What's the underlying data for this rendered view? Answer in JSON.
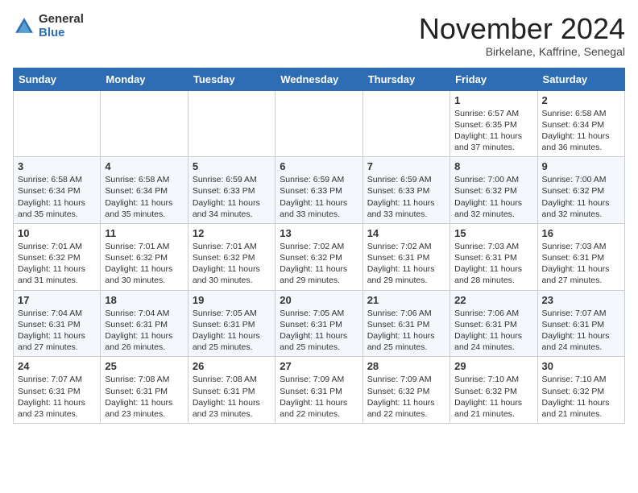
{
  "header": {
    "logo_general": "General",
    "logo_blue": "Blue",
    "month_title": "November 2024",
    "location": "Birkelane, Kaffrine, Senegal"
  },
  "weekdays": [
    "Sunday",
    "Monday",
    "Tuesday",
    "Wednesday",
    "Thursday",
    "Friday",
    "Saturday"
  ],
  "weeks": [
    [
      {
        "day": "",
        "info": ""
      },
      {
        "day": "",
        "info": ""
      },
      {
        "day": "",
        "info": ""
      },
      {
        "day": "",
        "info": ""
      },
      {
        "day": "",
        "info": ""
      },
      {
        "day": "1",
        "info": "Sunrise: 6:57 AM\nSunset: 6:35 PM\nDaylight: 11 hours and 37 minutes."
      },
      {
        "day": "2",
        "info": "Sunrise: 6:58 AM\nSunset: 6:34 PM\nDaylight: 11 hours and 36 minutes."
      }
    ],
    [
      {
        "day": "3",
        "info": "Sunrise: 6:58 AM\nSunset: 6:34 PM\nDaylight: 11 hours and 35 minutes."
      },
      {
        "day": "4",
        "info": "Sunrise: 6:58 AM\nSunset: 6:34 PM\nDaylight: 11 hours and 35 minutes."
      },
      {
        "day": "5",
        "info": "Sunrise: 6:59 AM\nSunset: 6:33 PM\nDaylight: 11 hours and 34 minutes."
      },
      {
        "day": "6",
        "info": "Sunrise: 6:59 AM\nSunset: 6:33 PM\nDaylight: 11 hours and 33 minutes."
      },
      {
        "day": "7",
        "info": "Sunrise: 6:59 AM\nSunset: 6:33 PM\nDaylight: 11 hours and 33 minutes."
      },
      {
        "day": "8",
        "info": "Sunrise: 7:00 AM\nSunset: 6:32 PM\nDaylight: 11 hours and 32 minutes."
      },
      {
        "day": "9",
        "info": "Sunrise: 7:00 AM\nSunset: 6:32 PM\nDaylight: 11 hours and 32 minutes."
      }
    ],
    [
      {
        "day": "10",
        "info": "Sunrise: 7:01 AM\nSunset: 6:32 PM\nDaylight: 11 hours and 31 minutes."
      },
      {
        "day": "11",
        "info": "Sunrise: 7:01 AM\nSunset: 6:32 PM\nDaylight: 11 hours and 30 minutes."
      },
      {
        "day": "12",
        "info": "Sunrise: 7:01 AM\nSunset: 6:32 PM\nDaylight: 11 hours and 30 minutes."
      },
      {
        "day": "13",
        "info": "Sunrise: 7:02 AM\nSunset: 6:32 PM\nDaylight: 11 hours and 29 minutes."
      },
      {
        "day": "14",
        "info": "Sunrise: 7:02 AM\nSunset: 6:31 PM\nDaylight: 11 hours and 29 minutes."
      },
      {
        "day": "15",
        "info": "Sunrise: 7:03 AM\nSunset: 6:31 PM\nDaylight: 11 hours and 28 minutes."
      },
      {
        "day": "16",
        "info": "Sunrise: 7:03 AM\nSunset: 6:31 PM\nDaylight: 11 hours and 27 minutes."
      }
    ],
    [
      {
        "day": "17",
        "info": "Sunrise: 7:04 AM\nSunset: 6:31 PM\nDaylight: 11 hours and 27 minutes."
      },
      {
        "day": "18",
        "info": "Sunrise: 7:04 AM\nSunset: 6:31 PM\nDaylight: 11 hours and 26 minutes."
      },
      {
        "day": "19",
        "info": "Sunrise: 7:05 AM\nSunset: 6:31 PM\nDaylight: 11 hours and 25 minutes."
      },
      {
        "day": "20",
        "info": "Sunrise: 7:05 AM\nSunset: 6:31 PM\nDaylight: 11 hours and 25 minutes."
      },
      {
        "day": "21",
        "info": "Sunrise: 7:06 AM\nSunset: 6:31 PM\nDaylight: 11 hours and 25 minutes."
      },
      {
        "day": "22",
        "info": "Sunrise: 7:06 AM\nSunset: 6:31 PM\nDaylight: 11 hours and 24 minutes."
      },
      {
        "day": "23",
        "info": "Sunrise: 7:07 AM\nSunset: 6:31 PM\nDaylight: 11 hours and 24 minutes."
      }
    ],
    [
      {
        "day": "24",
        "info": "Sunrise: 7:07 AM\nSunset: 6:31 PM\nDaylight: 11 hours and 23 minutes."
      },
      {
        "day": "25",
        "info": "Sunrise: 7:08 AM\nSunset: 6:31 PM\nDaylight: 11 hours and 23 minutes."
      },
      {
        "day": "26",
        "info": "Sunrise: 7:08 AM\nSunset: 6:31 PM\nDaylight: 11 hours and 23 minutes."
      },
      {
        "day": "27",
        "info": "Sunrise: 7:09 AM\nSunset: 6:31 PM\nDaylight: 11 hours and 22 minutes."
      },
      {
        "day": "28",
        "info": "Sunrise: 7:09 AM\nSunset: 6:32 PM\nDaylight: 11 hours and 22 minutes."
      },
      {
        "day": "29",
        "info": "Sunrise: 7:10 AM\nSunset: 6:32 PM\nDaylight: 11 hours and 21 minutes."
      },
      {
        "day": "30",
        "info": "Sunrise: 7:10 AM\nSunset: 6:32 PM\nDaylight: 11 hours and 21 minutes."
      }
    ]
  ]
}
